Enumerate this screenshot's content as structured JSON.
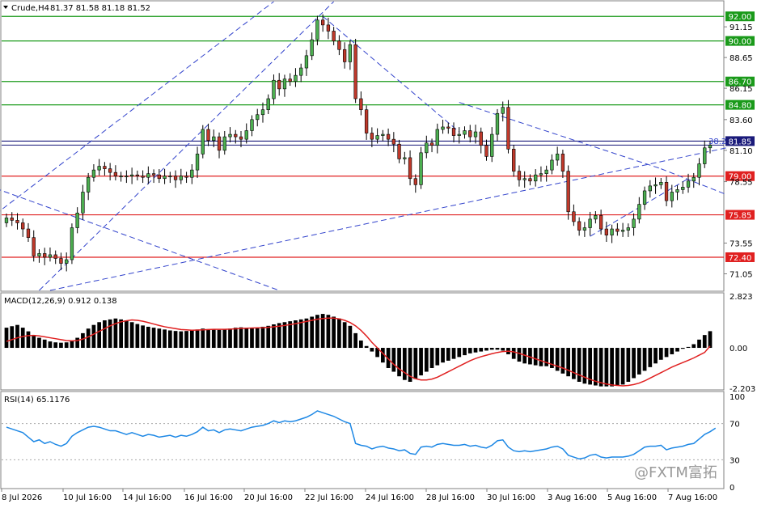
{
  "header": {
    "symbol": "Crude,H4",
    "ohlc": "81.37 81.58 81.18 81.52",
    "macd_label": "MACD(12,26,9) 0.912 0.138",
    "rsi_label": "RSI(14) 65.1176"
  },
  "colors": {
    "bull_body": "#4caf50",
    "bear_body": "#c0392b",
    "support": "#e02020",
    "resistance": "#1a9a1a",
    "price_line": "#1a1a7a",
    "trend": "#3344cc",
    "macd_hist": "#000000",
    "signal": "#e02020",
    "rsi": "#1e88e5"
  },
  "chart_data": [
    {
      "type": "candlestick",
      "title": "",
      "ylim": [
        69.7,
        93.2
      ],
      "y_ticks": [
        "92.00",
        "91.15",
        "90.00",
        "88.65",
        "86.70",
        "86.15",
        "84.80",
        "83.60",
        "81.85",
        "81.10",
        "79.00",
        "78.55",
        "75.85",
        "73.55",
        "72.40",
        "71.05"
      ],
      "x_ticks": [
        "8 Jul 2026",
        "10 Jul 16:00",
        "14 Jul 16:00",
        "16 Jul 16:00",
        "20 Jul 16:00",
        "22 Jul 16:00",
        "24 Jul 16:00",
        "28 Jul 16:00",
        "30 Jul 16:00",
        "3 Aug 16:00",
        "5 Aug 16:00",
        "7 Aug 16:00"
      ],
      "levels": [
        {
          "label": "92.00",
          "value": 92.0,
          "kind": "resistance"
        },
        {
          "label": "90.00",
          "value": 90.0,
          "kind": "resistance"
        },
        {
          "label": "86.70",
          "value": 86.7,
          "kind": "resistance"
        },
        {
          "label": "84.80",
          "value": 84.8,
          "kind": "resistance"
        },
        {
          "label": "81.85",
          "value": 81.85,
          "kind": "current"
        },
        {
          "label": "79.00",
          "value": 79.0,
          "kind": "support"
        },
        {
          "label": "75.85",
          "value": 75.85,
          "kind": "support"
        },
        {
          "label": "72.40",
          "value": 72.4,
          "kind": "support"
        }
      ],
      "fib_label": "38.2",
      "close_path": [
        75.6,
        75.4,
        75.2,
        74.7,
        74.0,
        72.5,
        72.7,
        72.4,
        72.6,
        72.3,
        71.9,
        72.2,
        74.8,
        76.0,
        77.7,
        78.9,
        79.5,
        79.8,
        79.6,
        79.3,
        79.0,
        79.0,
        79.0,
        79.1,
        79.0,
        78.9,
        79.2,
        79.1,
        78.8,
        79.0,
        79.0,
        78.7,
        79.0,
        78.9,
        79.5,
        80.8,
        82.8,
        81.9,
        82.2,
        81.1,
        82.2,
        82.4,
        82.2,
        82.0,
        82.7,
        83.6,
        84.0,
        84.4,
        85.3,
        86.8,
        86.1,
        86.9,
        86.7,
        87.2,
        87.8,
        88.8,
        90.1,
        91.7,
        91.3,
        90.8,
        90.0,
        89.3,
        88.3,
        89.7,
        85.3,
        84.4,
        82.5,
        82.0,
        82.3,
        82.4,
        82.0,
        81.6,
        80.4,
        80.5,
        78.8,
        78.3,
        80.9,
        81.7,
        81.5,
        82.8,
        83.0,
        82.9,
        82.3,
        82.4,
        82.7,
        82.2,
        82.6,
        81.5,
        80.6,
        82.4,
        84.1,
        84.6,
        81.2,
        79.4,
        78.7,
        78.8,
        78.6,
        79.1,
        79.2,
        79.5,
        80.3,
        80.8,
        79.4,
        76.1,
        75.3,
        74.6,
        74.8,
        75.5,
        75.8,
        74.7,
        74.2,
        74.7,
        74.5,
        74.6,
        74.8,
        75.5,
        76.7,
        77.8,
        78.2,
        78.3,
        78.5,
        77.0,
        77.7,
        77.9,
        78.1,
        78.6,
        78.9,
        80.0,
        81.3,
        81.52
      ],
      "series_macd": {
        "name": "MACD(12,26,9)",
        "ylim": [
          -2.203,
          2.823
        ],
        "ticks": [
          "2.823",
          "0.00",
          "-2.203"
        ],
        "histogram": [
          1.1,
          1.18,
          1.25,
          1.1,
          0.9,
          0.7,
          0.55,
          0.45,
          0.35,
          0.3,
          0.28,
          0.3,
          0.4,
          0.55,
          0.8,
          1.05,
          1.25,
          1.4,
          1.5,
          1.55,
          1.6,
          1.55,
          1.5,
          1.4,
          1.3,
          1.22,
          1.15,
          1.1,
          1.05,
          1.0,
          0.95,
          0.92,
          0.9,
          0.92,
          0.95,
          1.0,
          1.05,
          1.02,
          1.0,
          0.98,
          1.0,
          1.05,
          1.1,
          1.12,
          1.1,
          1.08,
          1.1,
          1.15,
          1.2,
          1.28,
          1.35,
          1.4,
          1.45,
          1.5,
          1.55,
          1.6,
          1.7,
          1.8,
          1.85,
          1.8,
          1.7,
          1.6,
          1.4,
          1.2,
          0.8,
          0.4,
          0.1,
          -0.2,
          -0.5,
          -0.8,
          -1.1,
          -1.3,
          -1.55,
          -1.75,
          -1.85,
          -1.7,
          -1.5,
          -1.3,
          -1.1,
          -0.95,
          -0.8,
          -0.7,
          -0.6,
          -0.5,
          -0.4,
          -0.3,
          -0.25,
          -0.2,
          -0.15,
          -0.1,
          -0.1,
          -0.15,
          -0.35,
          -0.6,
          -0.75,
          -0.85,
          -0.9,
          -0.95,
          -1.0,
          -1.0,
          -1.1,
          -1.25,
          -1.4,
          -1.55,
          -1.7,
          -1.85,
          -1.95,
          -2.0,
          -2.05,
          -2.1,
          -2.1,
          -2.1,
          -2.05,
          -2.0,
          -1.85,
          -1.65,
          -1.45,
          -1.25,
          -1.05,
          -0.85,
          -0.65,
          -0.5,
          -0.35,
          -0.2,
          -0.05,
          0.05,
          0.2,
          0.45,
          0.7,
          0.91
        ],
        "signal": [
          0.35,
          0.45,
          0.55,
          0.62,
          0.67,
          0.68,
          0.65,
          0.6,
          0.55,
          0.5,
          0.45,
          0.4,
          0.38,
          0.4,
          0.48,
          0.6,
          0.75,
          0.9,
          1.05,
          1.2,
          1.32,
          1.42,
          1.48,
          1.52,
          1.5,
          1.45,
          1.38,
          1.3,
          1.22,
          1.15,
          1.1,
          1.05,
          1.0,
          0.98,
          0.96,
          0.97,
          0.98,
          1.0,
          1.01,
          1.01,
          1.01,
          1.02,
          1.04,
          1.06,
          1.07,
          1.08,
          1.09,
          1.1,
          1.12,
          1.15,
          1.18,
          1.22,
          1.27,
          1.32,
          1.38,
          1.44,
          1.5,
          1.56,
          1.6,
          1.62,
          1.62,
          1.58,
          1.5,
          1.38,
          1.2,
          0.95,
          0.65,
          0.3,
          0.0,
          -0.3,
          -0.6,
          -0.9,
          -1.15,
          -1.35,
          -1.55,
          -1.68,
          -1.75,
          -1.75,
          -1.7,
          -1.6,
          -1.45,
          -1.3,
          -1.15,
          -1.0,
          -0.85,
          -0.7,
          -0.58,
          -0.48,
          -0.4,
          -0.32,
          -0.25,
          -0.2,
          -0.18,
          -0.22,
          -0.3,
          -0.4,
          -0.5,
          -0.6,
          -0.7,
          -0.8,
          -0.9,
          -1.0,
          -1.1,
          -1.22,
          -1.35,
          -1.48,
          -1.6,
          -1.72,
          -1.82,
          -1.9,
          -1.97,
          -2.02,
          -2.05,
          -2.07,
          -2.05,
          -2.0,
          -1.92,
          -1.8,
          -1.65,
          -1.5,
          -1.35,
          -1.2,
          -1.05,
          -0.92,
          -0.8,
          -0.68,
          -0.55,
          -0.4,
          -0.25,
          0.1
        ]
      },
      "series_rsi": {
        "name": "RSI(14)",
        "ylim": [
          0,
          100
        ],
        "ticks": [
          "100",
          "70",
          "30",
          "0"
        ],
        "values": [
          66,
          64,
          62,
          60,
          55,
          50,
          52,
          48,
          50,
          47,
          45,
          48,
          56,
          60,
          63,
          66,
          67,
          66,
          64,
          62,
          62,
          60,
          58,
          60,
          58,
          56,
          58,
          57,
          55,
          56,
          57,
          55,
          57,
          56,
          58,
          61,
          66,
          62,
          63,
          60,
          63,
          64,
          63,
          62,
          64,
          66,
          67,
          68,
          70,
          73,
          71,
          73,
          72,
          73,
          75,
          77,
          80,
          84,
          82,
          80,
          78,
          75,
          72,
          70,
          48,
          46,
          45,
          42,
          44,
          45,
          43,
          42,
          40,
          41,
          37,
          36,
          44,
          45,
          44,
          47,
          48,
          47,
          46,
          46,
          47,
          45,
          46,
          44,
          43,
          46,
          51,
          52,
          44,
          40,
          39,
          40,
          39,
          40,
          41,
          42,
          44,
          45,
          42,
          35,
          33,
          31,
          32,
          35,
          36,
          33,
          32,
          33,
          33,
          33,
          34,
          36,
          40,
          44,
          45,
          45,
          46,
          41,
          43,
          44,
          45,
          47,
          48,
          53,
          58,
          61,
          65
        ]
      }
    }
  ],
  "watermark": "@FXTM富拓"
}
